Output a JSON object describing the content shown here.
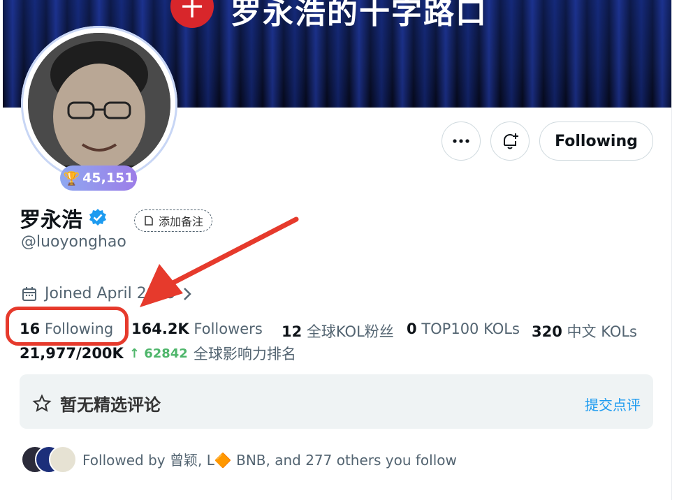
{
  "banner": {
    "title": "罗永浩的十字路口",
    "logo_glyph": "十"
  },
  "profile": {
    "score": "45,151",
    "trophy_icon": "trophy-icon",
    "name": "罗永浩",
    "handle": "@luoyonghao",
    "note_button": "添加备注",
    "joined": "Joined April 2009",
    "follow_button": "Following"
  },
  "stats": {
    "following_count": "16",
    "following_label": "Following",
    "followers_count": "164.2K",
    "followers_label": "Followers",
    "kol_fans_count": "12",
    "kol_fans_label": "全球KOL粉丝",
    "top100_count": "0",
    "top100_label": "TOP100 KOLs",
    "cn_kols_count": "320",
    "cn_kols_label": "中文 KOLs"
  },
  "rank": {
    "value": "21,977/200K",
    "delta": "62842",
    "label": "全球影响力排名"
  },
  "review": {
    "title": "暂无精选评论",
    "submit": "提交点评"
  },
  "followed_by": {
    "text": "Followed by 曾颖, L🔶 BNB, and 277 others you follow"
  },
  "colors": {
    "accent": "#1d9bf0",
    "annotation_red": "#e63a2c",
    "verified": "#1d9bf0"
  }
}
